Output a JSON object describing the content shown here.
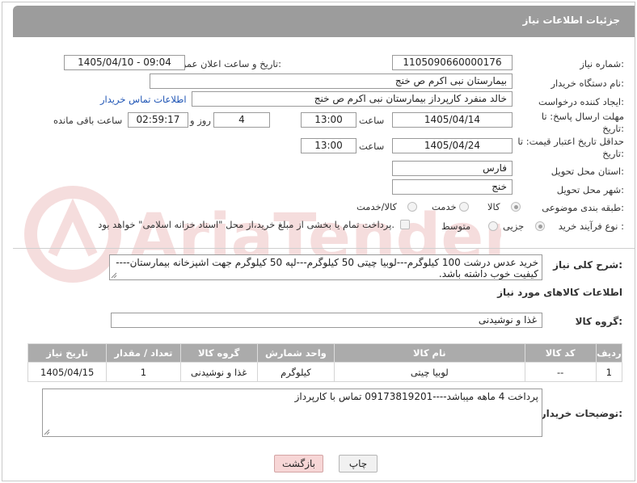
{
  "header": {
    "title": "جزئیات اطلاعات نیاز"
  },
  "form": {
    "need_number_label": "شماره نیاز:",
    "need_number": "1105090660000176",
    "announce_label": "تاریخ و ساعت اعلان عمومی:",
    "announce_value": "1405/04/10 - 09:04",
    "buyer_org_label": "نام دستگاه خریدار:",
    "buyer_org": "بیمارستان نبی اکرم  ص  خنج",
    "creator_label": "ایجاد کننده درخواست:",
    "creator": "خالد منفرد کارپرداز بیمارستان نبی اکرم  ص  خنج",
    "buyer_contact_link": "اطلاعات تماس خریدار",
    "deadline_label": "مهلت ارسال پاسخ: تا تاریخ:",
    "deadline_date": "1405/04/14",
    "time_label": "ساعت",
    "deadline_time": "13:00",
    "days_value": "4",
    "days_label": "روز و",
    "remaining_time": "02:59:17",
    "remaining_label": "ساعت باقی مانده",
    "price_validity_label": "حداقل تاریخ اعتبار قیمت: تا تاریخ:",
    "price_validity_date": "1405/04/24",
    "price_validity_time": "13:00",
    "province_label": "استان محل تحویل:",
    "province": "فارس",
    "city_label": "شهر محل تحویل:",
    "city": "خنج",
    "category_label": "طبقه بندی موضوعی:",
    "category_options": [
      "کالا",
      "خدمت",
      "کالا/خدمت"
    ],
    "category_selected": "کالا",
    "process_label": "نوع فرآیند خرید :",
    "process_options": [
      "جزیی",
      "متوسط"
    ],
    "process_selected": "جزیی",
    "payment_note": "پرداخت تمام یا بخشی از مبلغ خرید،از محل \"اسناد خزانه اسلامی\" خواهد بود."
  },
  "description": {
    "label": "شرح کلی نیاز:",
    "text": "خرید عدس درشت 100 کیلوگرم---لوبیا چیتی 50 کیلوگرم---لپه 50 کیلوگرم جهت اشپزخانه بیمارستان---- کیفیت خوب داشته باشد."
  },
  "goods": {
    "section_title": "اطلاعات کالاهای مورد نیاز",
    "group_label": "گروه کالا:",
    "group_value": "غذا و نوشیدنی",
    "table": {
      "headers": [
        "ردیف",
        "کد کالا",
        "نام کالا",
        "واحد شمارش",
        "گروه کالا",
        "تعداد / مقدار",
        "تاریخ نیاز"
      ],
      "rows": [
        [
          "1",
          "--",
          "لوبیا چیتی",
          "کیلوگرم",
          "غذا و نوشیدنی",
          "1",
          "1405/04/15"
        ]
      ]
    }
  },
  "buyer_notes": {
    "label": "توضیحات خریدار:",
    "text": "پرداخت 4 ماهه میباشد----09173819201 تماس با کارپرداز"
  },
  "buttons": {
    "print": "چاپ",
    "back": "بازگشت"
  },
  "watermark_text": "AriaTender.net"
}
